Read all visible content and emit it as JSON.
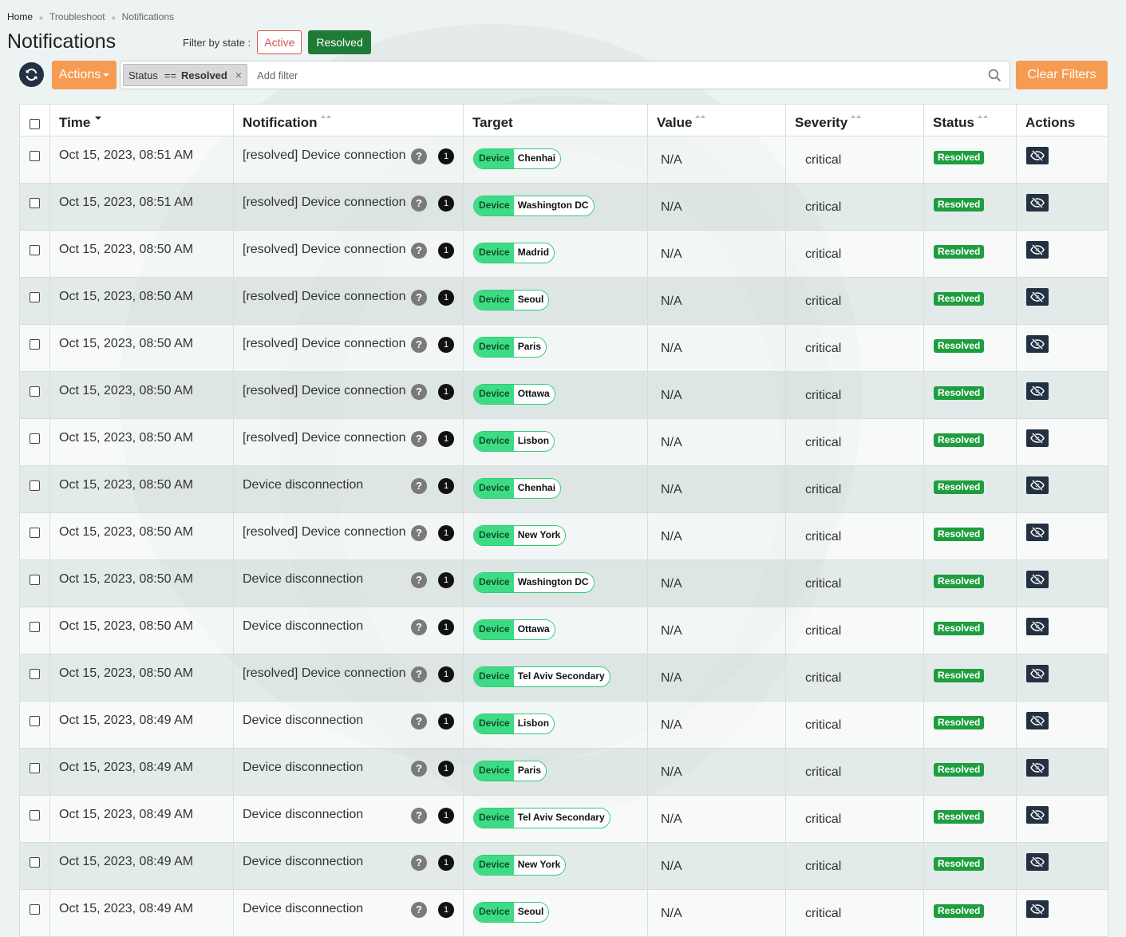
{
  "breadcrumb": [
    "Home",
    "Troubleshoot",
    "Notifications"
  ],
  "page_title": "Notifications",
  "state_filter": {
    "label": "Filter by state :",
    "active_label": "Active",
    "resolved_label": "Resolved",
    "selected": "Resolved"
  },
  "toolbar": {
    "actions_label": "Actions",
    "clear_filters_label": "Clear Filters",
    "refresh_icon": "refresh-icon"
  },
  "filter": {
    "chip": {
      "field": "Status",
      "operator": "==",
      "value": "Resolved"
    },
    "placeholder": "Add filter",
    "search_icon": "search-icon"
  },
  "table": {
    "columns": [
      "Time",
      "Notification",
      "Target",
      "Value",
      "Severity",
      "Status",
      "Actions"
    ],
    "sorted_column": "Time",
    "sort_direction": "desc",
    "rows": [
      {
        "time": "Oct 15, 2023, 08:51 AM",
        "notification": "[resolved] Device connection",
        "count": "1",
        "target_type": "Device",
        "target_name": "Chenhai",
        "value": "N/A",
        "severity": "critical",
        "status": "Resolved"
      },
      {
        "time": "Oct 15, 2023, 08:51 AM",
        "notification": "[resolved] Device connection",
        "count": "1",
        "target_type": "Device",
        "target_name": "Washington DC",
        "value": "N/A",
        "severity": "critical",
        "status": "Resolved"
      },
      {
        "time": "Oct 15, 2023, 08:50 AM",
        "notification": "[resolved] Device connection",
        "count": "1",
        "target_type": "Device",
        "target_name": "Madrid",
        "value": "N/A",
        "severity": "critical",
        "status": "Resolved"
      },
      {
        "time": "Oct 15, 2023, 08:50 AM",
        "notification": "[resolved] Device connection",
        "count": "1",
        "target_type": "Device",
        "target_name": "Seoul",
        "value": "N/A",
        "severity": "critical",
        "status": "Resolved"
      },
      {
        "time": "Oct 15, 2023, 08:50 AM",
        "notification": "[resolved] Device connection",
        "count": "1",
        "target_type": "Device",
        "target_name": "Paris",
        "value": "N/A",
        "severity": "critical",
        "status": "Resolved"
      },
      {
        "time": "Oct 15, 2023, 08:50 AM",
        "notification": "[resolved] Device connection",
        "count": "1",
        "target_type": "Device",
        "target_name": "Ottawa",
        "value": "N/A",
        "severity": "critical",
        "status": "Resolved"
      },
      {
        "time": "Oct 15, 2023, 08:50 AM",
        "notification": "[resolved] Device connection",
        "count": "1",
        "target_type": "Device",
        "target_name": "Lisbon",
        "value": "N/A",
        "severity": "critical",
        "status": "Resolved"
      },
      {
        "time": "Oct 15, 2023, 08:50 AM",
        "notification": "Device disconnection",
        "count": "1",
        "target_type": "Device",
        "target_name": "Chenhai",
        "value": "N/A",
        "severity": "critical",
        "status": "Resolved"
      },
      {
        "time": "Oct 15, 2023, 08:50 AM",
        "notification": "[resolved] Device connection",
        "count": "1",
        "target_type": "Device",
        "target_name": "New York",
        "value": "N/A",
        "severity": "critical",
        "status": "Resolved"
      },
      {
        "time": "Oct 15, 2023, 08:50 AM",
        "notification": "Device disconnection",
        "count": "1",
        "target_type": "Device",
        "target_name": "Washington DC",
        "value": "N/A",
        "severity": "critical",
        "status": "Resolved"
      },
      {
        "time": "Oct 15, 2023, 08:50 AM",
        "notification": "Device disconnection",
        "count": "1",
        "target_type": "Device",
        "target_name": "Ottawa",
        "value": "N/A",
        "severity": "critical",
        "status": "Resolved"
      },
      {
        "time": "Oct 15, 2023, 08:50 AM",
        "notification": "[resolved] Device connection",
        "count": "1",
        "target_type": "Device",
        "target_name": "Tel Aviv Secondary",
        "value": "N/A",
        "severity": "critical",
        "status": "Resolved"
      },
      {
        "time": "Oct 15, 2023, 08:49 AM",
        "notification": "Device disconnection",
        "count": "1",
        "target_type": "Device",
        "target_name": "Lisbon",
        "value": "N/A",
        "severity": "critical",
        "status": "Resolved"
      },
      {
        "time": "Oct 15, 2023, 08:49 AM",
        "notification": "Device disconnection",
        "count": "1",
        "target_type": "Device",
        "target_name": "Paris",
        "value": "N/A",
        "severity": "critical",
        "status": "Resolved"
      },
      {
        "time": "Oct 15, 2023, 08:49 AM",
        "notification": "Device disconnection",
        "count": "1",
        "target_type": "Device",
        "target_name": "Tel Aviv Secondary",
        "value": "N/A",
        "severity": "critical",
        "status": "Resolved"
      },
      {
        "time": "Oct 15, 2023, 08:49 AM",
        "notification": "Device disconnection",
        "count": "1",
        "target_type": "Device",
        "target_name": "New York",
        "value": "N/A",
        "severity": "critical",
        "status": "Resolved"
      },
      {
        "time": "Oct 15, 2023, 08:49 AM",
        "notification": "Device disconnection",
        "count": "1",
        "target_type": "Device",
        "target_name": "Seoul",
        "value": "N/A",
        "severity": "critical",
        "status": "Resolved"
      }
    ],
    "row_action_icon": "hide-eye-icon"
  },
  "colors": {
    "accent_orange": "#f69b52",
    "resolved_green": "#1e7b35",
    "active_red": "#d9534f",
    "tag_green": "#3ddc84",
    "dark_navy": "#233142"
  }
}
